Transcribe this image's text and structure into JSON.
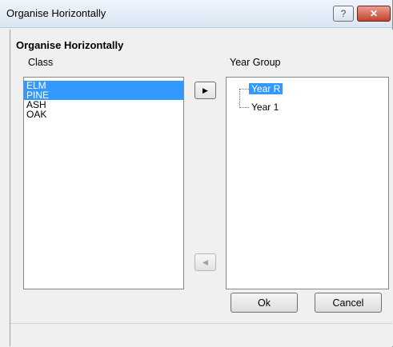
{
  "window": {
    "title": "Organise Horizontally",
    "help_glyph": "?",
    "close_glyph": "✕"
  },
  "panel": {
    "heading": "Organise Horizontally"
  },
  "class_column": {
    "label": "Class",
    "items": [
      {
        "label": "ELM",
        "selected": true
      },
      {
        "label": "PINE",
        "selected": true
      },
      {
        "label": "ASH",
        "selected": false
      },
      {
        "label": "OAK",
        "selected": false
      }
    ]
  },
  "year_column": {
    "label": "Year Group",
    "nodes": [
      {
        "label": "Year  R",
        "selected": true
      },
      {
        "label": "Year  1",
        "selected": false
      }
    ]
  },
  "controls": {
    "move_right_glyph": "▶",
    "move_left_glyph": "◀",
    "move_left_enabled": false
  },
  "buttons": {
    "ok": "Ok",
    "cancel": "Cancel"
  },
  "colors": {
    "selection": "#3399ff",
    "dialog_bg": "#f0f0f0",
    "close_button": "#c6412c"
  }
}
